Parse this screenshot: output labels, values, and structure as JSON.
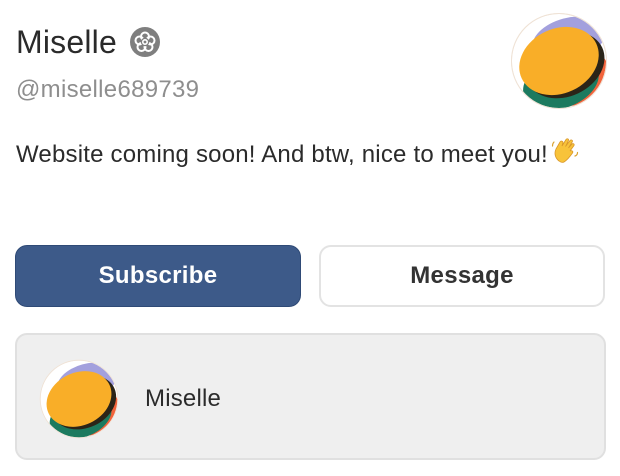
{
  "profile": {
    "display_name": "Miselle",
    "handle": "@miselle689739",
    "bio": "Website coming soon! And btw, nice to meet you!",
    "verified_icon": "flower-badge-icon",
    "emoji": "waving-hand-icon"
  },
  "actions": {
    "subscribe_label": "Subscribe",
    "message_label": "Message"
  },
  "card": {
    "name": "Miselle"
  },
  "colors": {
    "subscribe_bg": "#3d5a89",
    "card_bg": "#efefef",
    "handle_text": "#8e8e8e",
    "avatar_yellow": "#f9ae28",
    "avatar_green": "#1c7a5f",
    "avatar_orange": "#f2633b",
    "avatar_purple": "#a3a0dd"
  }
}
